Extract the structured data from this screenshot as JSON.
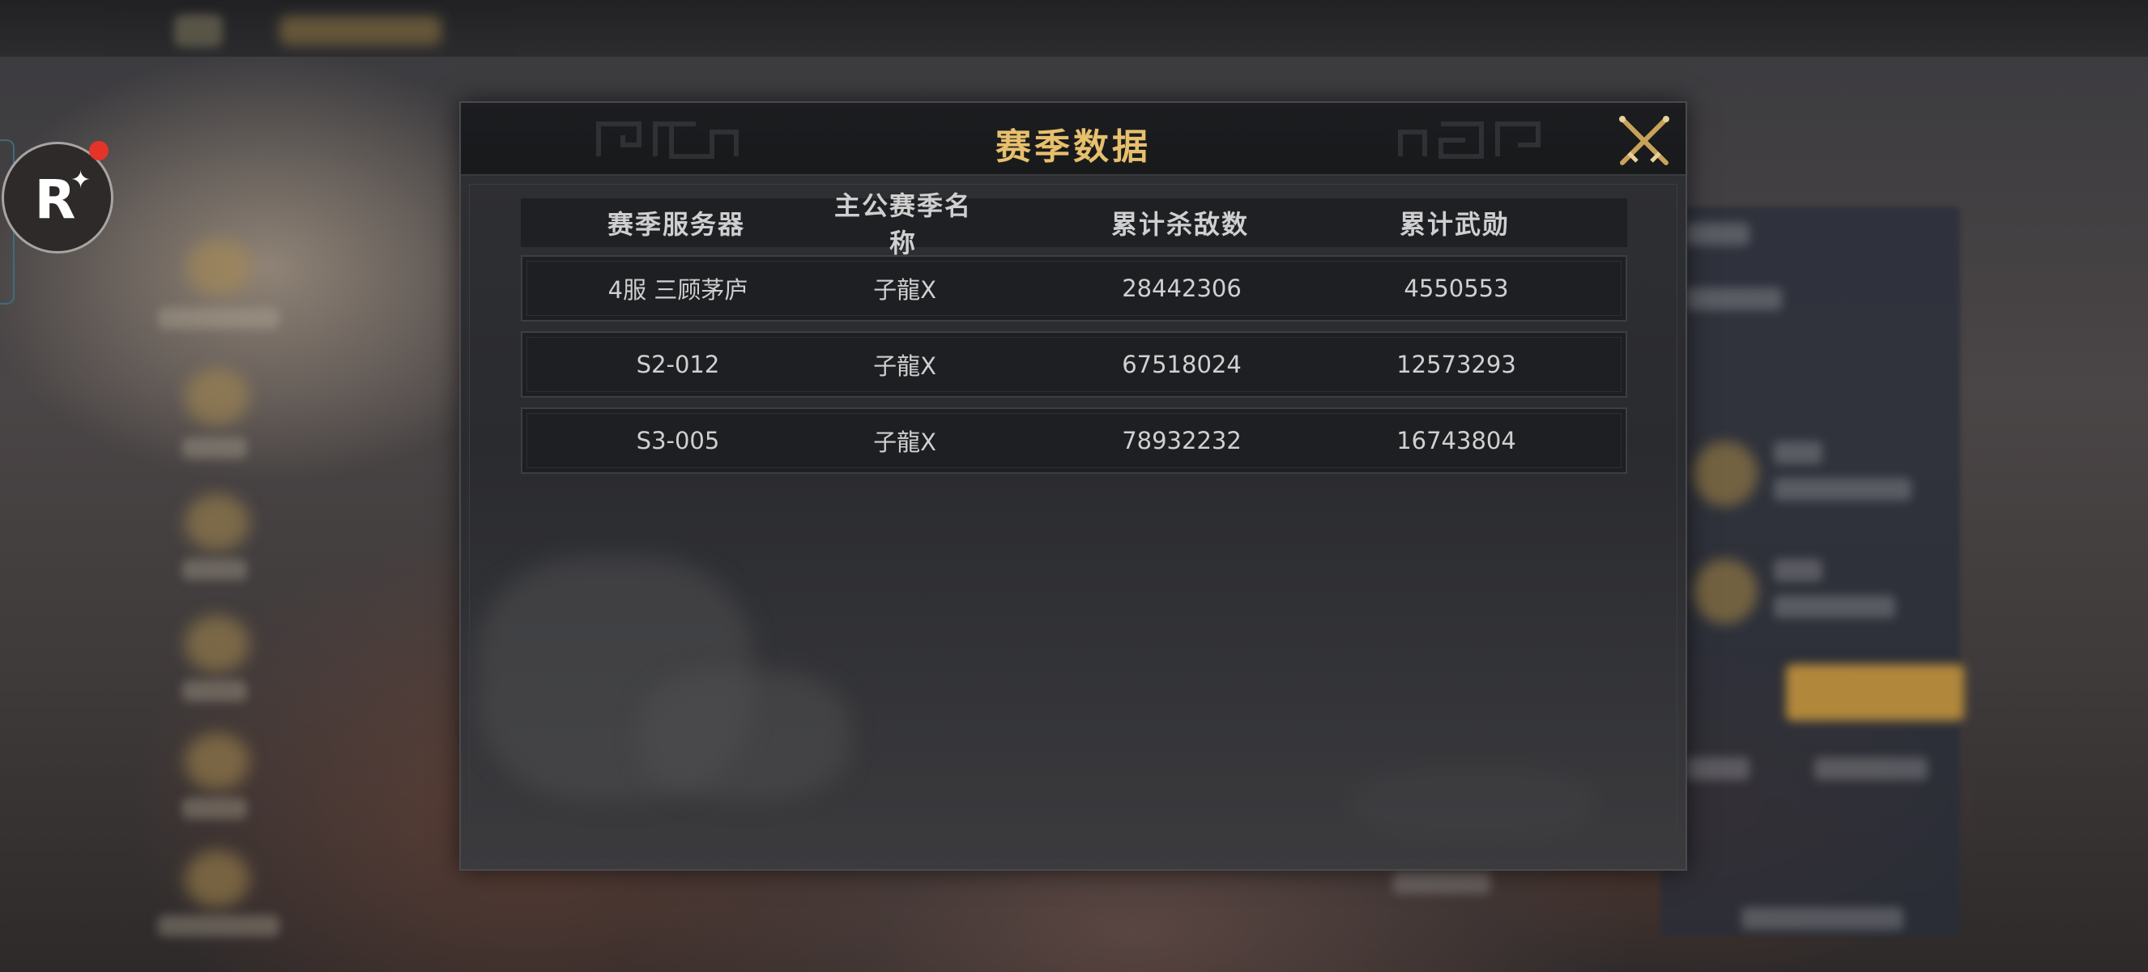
{
  "modal": {
    "title": "赛季数据",
    "columns": [
      "赛季服务器",
      "主公赛季名称",
      "累计杀敌数",
      "累计武勋"
    ],
    "rows": [
      {
        "server": "4服 三顾茅庐",
        "name": "子龍X",
        "kills": "28442306",
        "merit": "4550553"
      },
      {
        "server": "S2-012",
        "name": "子龍X",
        "kills": "67518024",
        "merit": "12573293"
      },
      {
        "server": "S3-005",
        "name": "子龍X",
        "kills": "78932232",
        "merit": "16743804"
      }
    ],
    "close_icon": "crossed-swords-icon"
  },
  "overlay_badge": {
    "letter": "R",
    "icon": "sparkle-icon",
    "notification_color": "#e5332a"
  },
  "colors": {
    "title_gold": "#e7c06d",
    "panel_bg": "#2f3034",
    "header_bg": "#1c1d20",
    "row_bg": "#1e1f22",
    "text": "#d0d0d0"
  }
}
